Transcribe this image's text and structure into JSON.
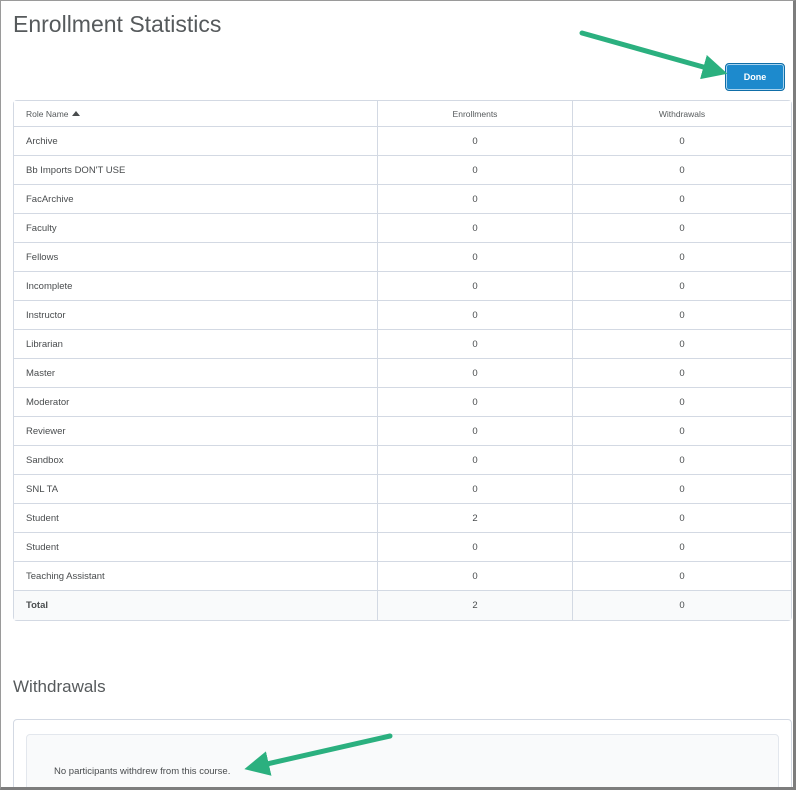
{
  "page": {
    "title": "Enrollment Statistics",
    "done_label": "Done"
  },
  "table": {
    "headers": {
      "role_name": "Role Name",
      "enrollments": "Enrollments",
      "withdrawals": "Withdrawals"
    },
    "rows": [
      {
        "role": "Archive",
        "enrollments": "0",
        "withdrawals": "0"
      },
      {
        "role": "Bb Imports DON'T USE",
        "enrollments": "0",
        "withdrawals": "0"
      },
      {
        "role": "FacArchive",
        "enrollments": "0",
        "withdrawals": "0"
      },
      {
        "role": "Faculty",
        "enrollments": "0",
        "withdrawals": "0"
      },
      {
        "role": "Fellows",
        "enrollments": "0",
        "withdrawals": "0"
      },
      {
        "role": "Incomplete",
        "enrollments": "0",
        "withdrawals": "0"
      },
      {
        "role": "Instructor",
        "enrollments": "0",
        "withdrawals": "0"
      },
      {
        "role": "Librarian",
        "enrollments": "0",
        "withdrawals": "0"
      },
      {
        "role": "Master",
        "enrollments": "0",
        "withdrawals": "0"
      },
      {
        "role": "Moderator",
        "enrollments": "0",
        "withdrawals": "0"
      },
      {
        "role": "Reviewer",
        "enrollments": "0",
        "withdrawals": "0"
      },
      {
        "role": "Sandbox",
        "enrollments": "0",
        "withdrawals": "0"
      },
      {
        "role": "SNL TA",
        "enrollments": "0",
        "withdrawals": "0"
      },
      {
        "role": "Student",
        "enrollments": "2",
        "withdrawals": "0"
      },
      {
        "role": "Student",
        "enrollments": "0",
        "withdrawals": "0"
      },
      {
        "role": "Teaching Assistant",
        "enrollments": "0",
        "withdrawals": "0"
      }
    ],
    "total": {
      "role": "Total",
      "enrollments": "2",
      "withdrawals": "0"
    }
  },
  "withdrawals_section": {
    "title": "Withdrawals",
    "empty_message": "No participants withdrew from this course."
  },
  "colors": {
    "accent": "#1d8acd",
    "annotation_arrow": "#2bb07f"
  },
  "icons": {
    "sort": "sort-ascending-icon"
  }
}
